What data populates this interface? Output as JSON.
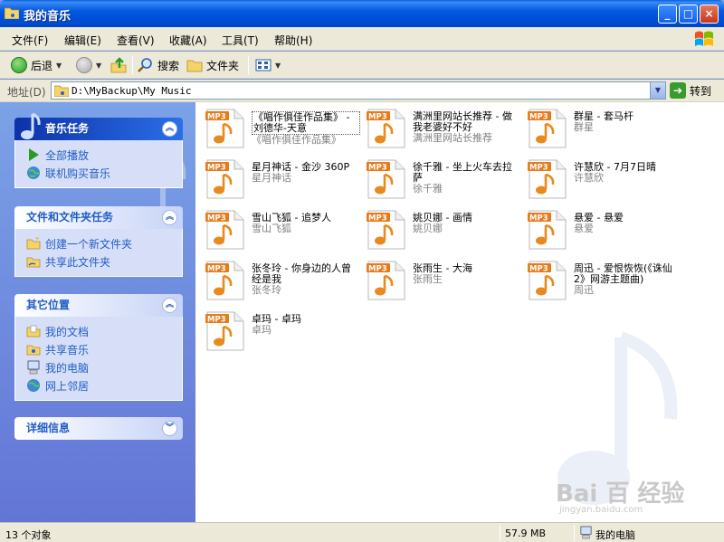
{
  "window": {
    "title": "我的音乐"
  },
  "menubar": {
    "items": [
      "文件(F)",
      "编辑(E)",
      "查看(V)",
      "收藏(A)",
      "工具(T)",
      "帮助(H)"
    ]
  },
  "toolbar": {
    "back_label": "后退",
    "search_label": "搜索",
    "folders_label": "文件夹"
  },
  "addressbar": {
    "label": "地址(D)",
    "path": "D:\\MyBackup\\My Music",
    "go_label": "转到"
  },
  "left_panels": [
    {
      "header": "音乐任务",
      "tasks": [
        "全部播放",
        "联机购买音乐"
      ]
    },
    {
      "header": "文件和文件夹任务",
      "tasks": [
        "创建一个新文件夹",
        "共享此文件夹"
      ]
    },
    {
      "header": "其它位置",
      "tasks": [
        "我的文档",
        "共享音乐",
        "我的电脑",
        "网上邻居"
      ]
    },
    {
      "header": "详细信息",
      "tasks": []
    }
  ],
  "files": [
    {
      "name": "《唱作俱佳作品集》 - 刘德华-天意",
      "artist": "《唱作俱佳作品集》"
    },
    {
      "name": "满洲里网站长推荐 - 做我老婆好不好",
      "artist": "满洲里网站长推荐"
    },
    {
      "name": "群星 - 套马杆",
      "artist": "群星"
    },
    {
      "name": "星月神话 - 金沙 360P",
      "artist": "星月神话"
    },
    {
      "name": "徐千雅 - 坐上火车去拉萨",
      "artist": "徐千雅"
    },
    {
      "name": "许慧欣 - 7月7日晴",
      "artist": "许慧欣"
    },
    {
      "name": "雪山飞狐 - 追梦人",
      "artist": "雪山飞狐"
    },
    {
      "name": "姚贝娜 - 画情",
      "artist": "姚贝娜"
    },
    {
      "name": "悬爱 - 悬爱",
      "artist": "悬爱"
    },
    {
      "name": "张冬玲 - 你身边的人曾经是我",
      "artist": "张冬玲"
    },
    {
      "name": "张雨生 - 大海",
      "artist": "张雨生"
    },
    {
      "name": "周迅 - 爱恨恢恢(《诛仙2》网游主题曲)",
      "artist": "周迅"
    },
    {
      "name": "卓玛 - 卓玛",
      "artist": "卓玛"
    }
  ],
  "watermark": {
    "brand": "Bai 百 经验",
    "url": "jingyan.baidu.com"
  },
  "statusbar": {
    "objects": "13 个对象",
    "size": "57.9 MB",
    "location": "我的电脑"
  },
  "colors": {
    "titlebar": "#0050d8",
    "left_pane": "#6375d6",
    "task_link": "#215dc6",
    "mp3_badge": "#e87a1a"
  }
}
